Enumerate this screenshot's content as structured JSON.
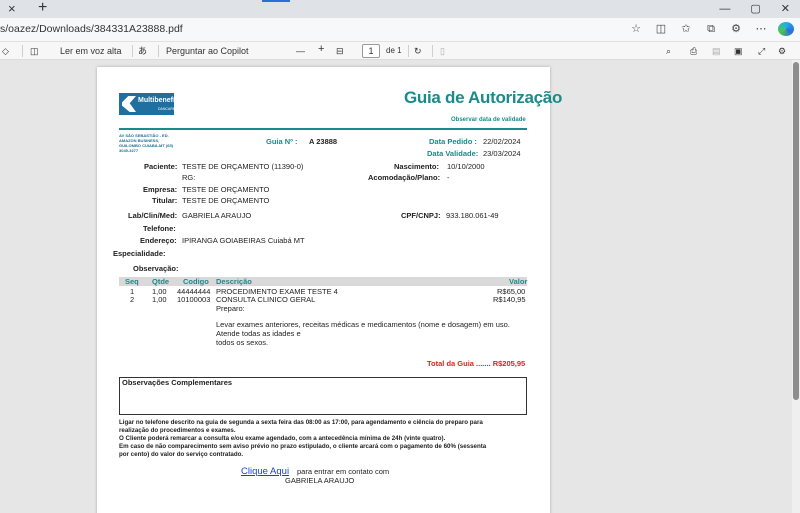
{
  "browser": {
    "tab_close_icon": "×",
    "new_tab_icon": "+",
    "window_controls": [
      "—",
      "▢",
      "✕"
    ],
    "url": "s/oazez/Downloads/384331A23888.pdf",
    "toolbar_icons": [
      "star-icon",
      "split-screen-icon",
      "favorites-icon",
      "collections-icon",
      "extensions-icon",
      "more-icon",
      "copilot-icon"
    ]
  },
  "pdf_toolbar": {
    "read_aloud": "Ler em voz alta",
    "aa": "あ",
    "ask_copilot": "Perguntar ao Copilot",
    "zoom_out": "—",
    "zoom_in": "+",
    "page_current": "1",
    "page_total": "de 1"
  },
  "doc": {
    "logo_brand": "Multibenefícios",
    "logo_sub": "DANCARE",
    "title": "Guia de Autorização",
    "validity_note": "Observar data de validade",
    "address": "AV SÃO SEBASTIÃO - ED. AMAZON BUSINESS, GUILOMBO CUIABÁ-MT (65) 3049-3277",
    "guia_label": "Guia Nº :",
    "guia_value": "A 23888",
    "data_pedido_label": "Data Pedido :",
    "data_pedido_value": "22/02/2024",
    "data_validade_label": "Data Validade:",
    "data_validade_value": "23/03/2024",
    "paciente_label": "Paciente:",
    "paciente_value": "TESTE DE ORÇAMENTO (11390-0)",
    "rg_label": "RG:",
    "nascimento_label": "Nascimento:",
    "nascimento_value": "10/10/2000",
    "acomodacao_label": "Acomodação/Plano:",
    "acomodacao_value": "-",
    "empresa_label": "Empresa:",
    "empresa_value": "TESTE DE ORÇAMENTO",
    "titular_label": "Titular:",
    "titular_value": "TESTE DE ORÇAMENTO",
    "lab_label": "Lab/Clin/Med:",
    "lab_value": "GABRIELA ARAUJO",
    "cpf_label": "CPF/CNPJ:",
    "cpf_value": "933.180.061-49",
    "telefone_label": "Telefone:",
    "endereco_label": "Endereço:",
    "endereco_value": "IPIRANGA GOIABEIRAS Cuiabá MT",
    "especialidade_label": "Especialidade:",
    "observacao_label": "Observação:",
    "table_headers": [
      "Seq",
      "Qtde",
      "Codigo",
      "Descrição",
      "Valor"
    ],
    "rows": [
      {
        "seq": "1",
        "qtde": "1,00",
        "codigo": "44444444",
        "descricao": "PROCEDIMENTO EXAME TESTE 4",
        "valor": "R$65,00"
      },
      {
        "seq": "2",
        "qtde": "1,00",
        "codigo": "10100003",
        "descricao": "CONSULTA CLINICO GERAL",
        "valor": "R$140,95"
      }
    ],
    "preparo": "Preparo:",
    "preparo_lines": [
      "Levar exames anteriores, receitas médicas e medicamentos (nome e dosagem) em uso.",
      "Atende todas as idades e",
      "todos os sexos."
    ],
    "total": "Total da Guia ....... R$205,95",
    "obs_title": "Observações Complementares",
    "notice": [
      "Ligar no telefone descrito na guia de segunda a sexta feira das 08:00 as 17:00, para agendamento e ciência do preparo para",
      "realização do procedimentos e exames.",
      "O Cliente poderá remarcar a consulta e/ou exame agendado, com a antecedência mínima de 24h (vinte quatro).",
      "Em caso de não comparecimento sem aviso prévio no prazo estipulado, o cliente arcará com o pagamento de 60% (sessenta",
      "por cento) do valor do serviço contratado."
    ],
    "contact_link": "Clique Aqui",
    "contact_text": "para entrar em contato com",
    "contact_name": "GABRIELA ARAUJO"
  }
}
